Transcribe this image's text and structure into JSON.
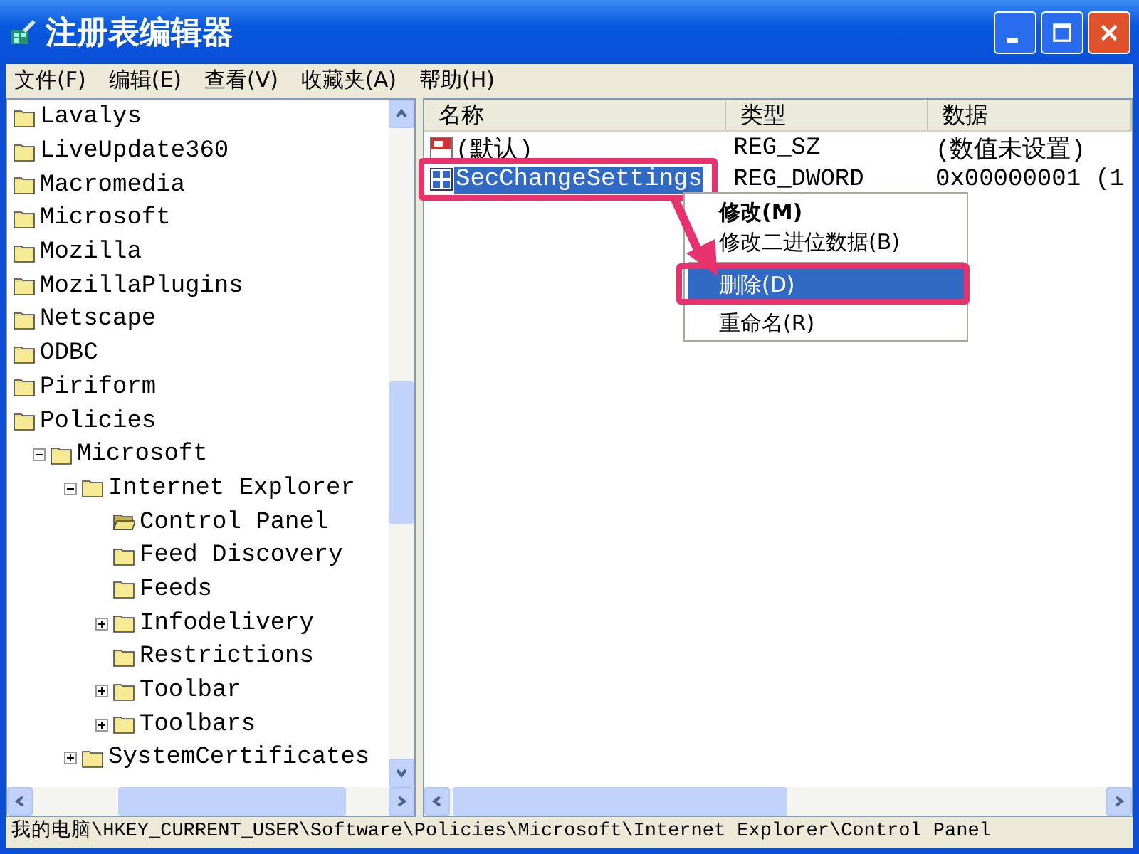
{
  "window": {
    "title": "注册表编辑器"
  },
  "menu": [
    "文件(F)",
    "编辑(E)",
    "查看(V)",
    "收藏夹(A)",
    "帮助(H)"
  ],
  "tree": [
    {
      "label": "Lavalys",
      "current": false
    },
    {
      "label": "LiveUpdate360",
      "current": false
    },
    {
      "label": "Macromedia",
      "current": false
    },
    {
      "label": "Microsoft",
      "current": false
    },
    {
      "label": "Mozilla",
      "current": false
    },
    {
      "label": "MozillaPlugins",
      "current": false
    },
    {
      "label": "Netscape",
      "current": false
    },
    {
      "label": "ODBC",
      "current": false
    },
    {
      "label": "Piriform",
      "current": false
    },
    {
      "label": "Policies",
      "current": false,
      "children": [
        {
          "label": "Microsoft",
          "current": false,
          "expanded": true,
          "children": [
            {
              "label": "Internet Explorer",
              "current": false,
              "expanded": true,
              "children": [
                {
                  "label": "Control Panel",
                  "current": true
                },
                {
                  "label": "Feed Discovery",
                  "current": false
                },
                {
                  "label": "Feeds",
                  "current": false
                },
                {
                  "label": "Infodelivery",
                  "current": false,
                  "expanded": false
                },
                {
                  "label": "Restrictions",
                  "current": false
                },
                {
                  "label": "Toolbar",
                  "current": false,
                  "expanded": false
                },
                {
                  "label": "Toolbars",
                  "current": false,
                  "expanded": false
                }
              ]
            },
            {
              "label": "SystemCertificates",
              "current": false,
              "expanded": false
            }
          ]
        }
      ]
    }
  ],
  "values": {
    "columns": [
      "名称",
      "类型",
      "数据"
    ],
    "rows": [
      {
        "kind": "string",
        "name": "(默认)",
        "type": "REG_SZ",
        "data": "(数值未设置)",
        "selected": false
      },
      {
        "kind": "binary",
        "name": "SecChangeSettings",
        "type": "REG_DWORD",
        "data": "0x00000001 (1",
        "selected": true
      }
    ]
  },
  "context_menu": [
    {
      "label": "修改(M)",
      "default": true,
      "selected": false
    },
    {
      "label": "修改二进位数据(B)",
      "default": false,
      "selected": false
    },
    {
      "kind": "separator"
    },
    {
      "label": "删除(D)",
      "default": false,
      "selected": true
    },
    {
      "label": "重命名(R)",
      "default": false,
      "selected": false
    }
  ],
  "status_bar": "我的电脑\\HKEY_CURRENT_USER\\Software\\Policies\\Microsoft\\Internet Explorer\\Control Panel"
}
